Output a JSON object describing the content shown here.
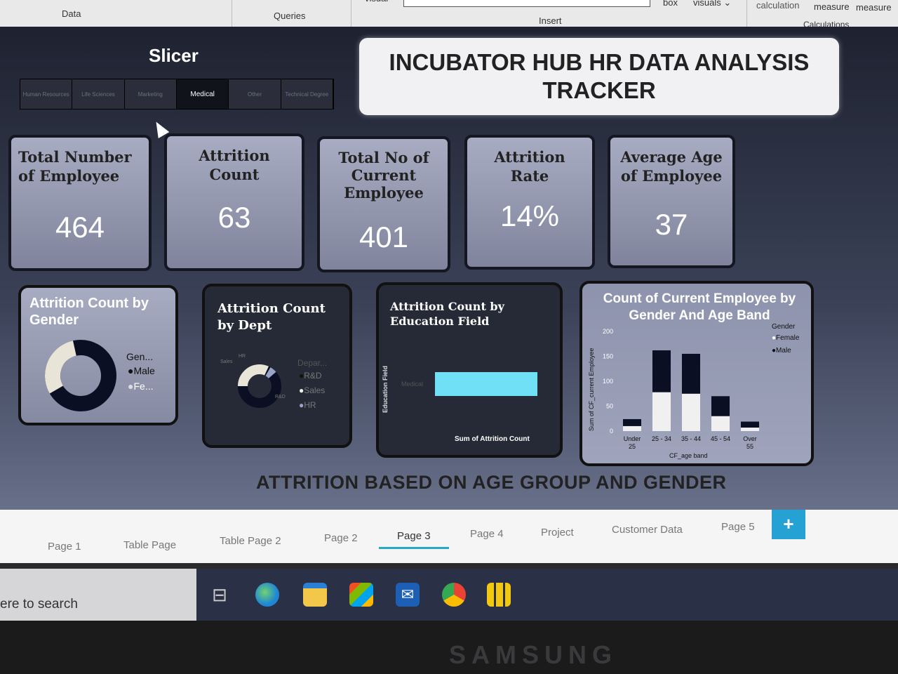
{
  "ribbon": {
    "data": "Data",
    "queries": "Queries",
    "visual": "visual",
    "insert": "Insert",
    "box": "box",
    "visuals": "visuals",
    "calculation": "calculation",
    "measure1": "measure",
    "measure2": "measure",
    "calculations": "Calculations"
  },
  "slicer": {
    "title": "Slicer",
    "options": [
      "Human Resources",
      "Life Sciences",
      "Marketing",
      "Medical",
      "Other",
      "Technical Degree"
    ],
    "selected": "Medical"
  },
  "report_title": "INCUBATOR HUB HR DATA ANALYSIS\nTRACKER",
  "kpis": [
    {
      "label": "Total Number of Employee",
      "value": "464"
    },
    {
      "label": "Attrition Count",
      "value": "63"
    },
    {
      "label": "Total No of Current Employee",
      "value": "401"
    },
    {
      "label": "Attrition Rate",
      "value": "14%"
    },
    {
      "label": "Average Age of Employee",
      "value": "37"
    }
  ],
  "gender_card": {
    "title": "Attrition Count by Gender",
    "legend_title": "Gen...",
    "legend": [
      "Male",
      "Fe..."
    ]
  },
  "dept_card": {
    "title": "Attrition Count by Dept",
    "legend_title": "Depar...",
    "legend": [
      "R&D",
      "Sales",
      "HR"
    ],
    "labels": [
      "Sales",
      "HR",
      "R&D"
    ]
  },
  "edu_card": {
    "title": "Attrition Count by Education Field",
    "ylabel": "Education Field",
    "xlabel": "Sum of Attrition Count",
    "bar_label": "Medical"
  },
  "age_card": {
    "title": "Count of Current Employee by Gender And Age Band",
    "ylabel": "Sum of CF_current Employee",
    "xlabel": "CF_age band",
    "legend_title": "Gender",
    "legend": [
      "Female",
      "Male"
    ]
  },
  "chart_data": {
    "type": "bar",
    "stacked": true,
    "categories": [
      "Under 25",
      "25 - 34",
      "35 - 44",
      "45 - 54",
      "Over 55"
    ],
    "series": [
      {
        "name": "Female",
        "values": [
          10,
          78,
          75,
          30,
          7
        ]
      },
      {
        "name": "Male",
        "values": [
          14,
          84,
          80,
          40,
          12
        ]
      }
    ],
    "title": "Count of Current Employee by Gender And Age Band",
    "xlabel": "CF_age band",
    "ylabel": "Sum of CF_current Employee",
    "ylim": [
      0,
      200
    ],
    "yticks": [
      "200",
      "150",
      "100",
      "50",
      "0"
    ],
    "colors": {
      "Female": "#f0f0f0",
      "Male": "#0b0f24"
    }
  },
  "bottom_title": "ATTRITION BASED ON AGE GROUP AND GENDER",
  "tabs": [
    "Page 1",
    "Table Page",
    "Table Page 2",
    "Page 2",
    "Page 3",
    "Page 4",
    "Project",
    "Customer Data",
    "Page 5"
  ],
  "active_tab": "Page 3",
  "add_tab": "+",
  "taskbar": {
    "search": "ere to search"
  },
  "monitor_brand": "SAMSUNG"
}
